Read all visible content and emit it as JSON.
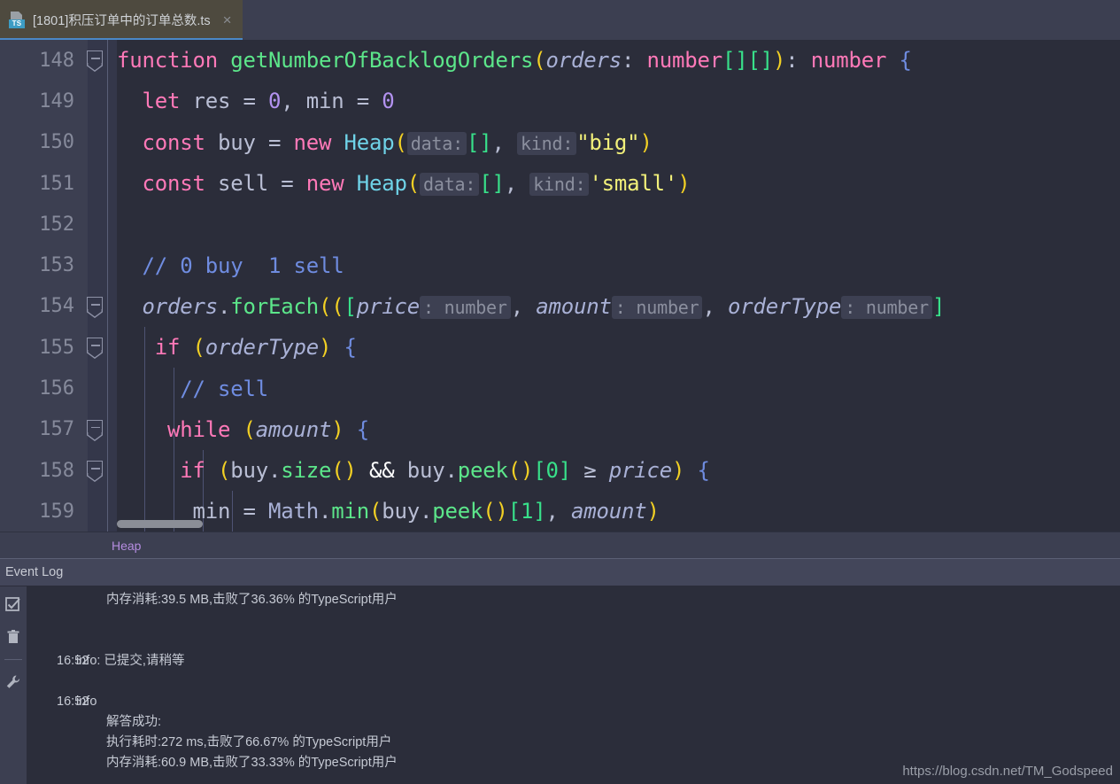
{
  "window": {
    "tab": {
      "icon": "typescript-file-icon",
      "badge": "TS",
      "title": "[1801]积压订单中的订单总数.ts",
      "close": "×"
    }
  },
  "editor": {
    "lines": [
      {
        "no": "148",
        "fold": true,
        "indent": 0
      },
      {
        "no": "149",
        "fold": false,
        "indent": 1
      },
      {
        "no": "150",
        "fold": false,
        "indent": 1
      },
      {
        "no": "151",
        "fold": false,
        "indent": 1
      },
      {
        "no": "152",
        "fold": false,
        "indent": 1
      },
      {
        "no": "153",
        "fold": false,
        "indent": 1
      },
      {
        "no": "154",
        "fold": true,
        "indent": 1
      },
      {
        "no": "155",
        "fold": true,
        "indent": 2
      },
      {
        "no": "156",
        "fold": false,
        "indent": 3
      },
      {
        "no": "157",
        "fold": true,
        "indent": 3
      },
      {
        "no": "158",
        "fold": true,
        "indent": 4
      },
      {
        "no": "159",
        "fold": false,
        "indent": 5
      }
    ],
    "code_text": [
      "function getNumberOfBacklogOrders(orders: number[][]): number {",
      "    let res = 0, min = 0",
      "    const buy = new Heap( data: [],  kind: \"big\")",
      "    const sell = new Heap( data: [],  kind: 'small')",
      "",
      "    // 0 buy  1 sell",
      "    orders.forEach((([price : number , amount : number , orderType : number ]",
      "      if (orderType) {",
      "        // sell",
      "        while (amount) {",
      "          if (buy.size() && buy.peek()[0] ≥ price) {",
      "            min = Math.min(buy.peek()[1], amount)"
    ],
    "inlay_hints": [
      "data:",
      "kind:",
      "data:",
      "kind:",
      ": number",
      ": number",
      ": number"
    ],
    "horizontal_scrollbar": true
  },
  "breadcrumb": {
    "item": "Heap"
  },
  "event_log": {
    "title": "Event Log",
    "tools": [
      "mark-all-read-icon",
      "clear-all-icon",
      "settings-wrench-icon"
    ],
    "entries": [
      {
        "time": "",
        "text": "内存消耗:39.5 MB,击败了36.36% 的TypeScript用户",
        "indent": true
      },
      {
        "time": "16:52",
        "text": "info: 已提交,请稍等",
        "indent": false
      },
      {
        "time": "16:52",
        "text": "info",
        "indent": false
      },
      {
        "time": "",
        "text": "解答成功:",
        "indent": true
      },
      {
        "time": "",
        "text": "执行耗时:272 ms,击败了66.67% 的TypeScript用户",
        "indent": true
      },
      {
        "time": "",
        "text": "内存消耗:60.9 MB,击败了33.33% 的TypeScript用户",
        "indent": true
      }
    ]
  },
  "watermark": "https://blog.csdn.net/TM_Godspeed",
  "colors": {
    "editor_bg": "#2b2d3a",
    "gutter_bg": "#3c3f51",
    "tab_active_bg": "#4e4a3f",
    "tab_underline": "#4a88c7",
    "keyword": "#ff79b8",
    "function": "#5ce68a",
    "string": "#f2f07a",
    "number": "#b392f0",
    "comment": "#6f8ce0",
    "bracket": "#38e08a",
    "paren": "#f2d024",
    "breadcrumb": "#b58ce0"
  }
}
